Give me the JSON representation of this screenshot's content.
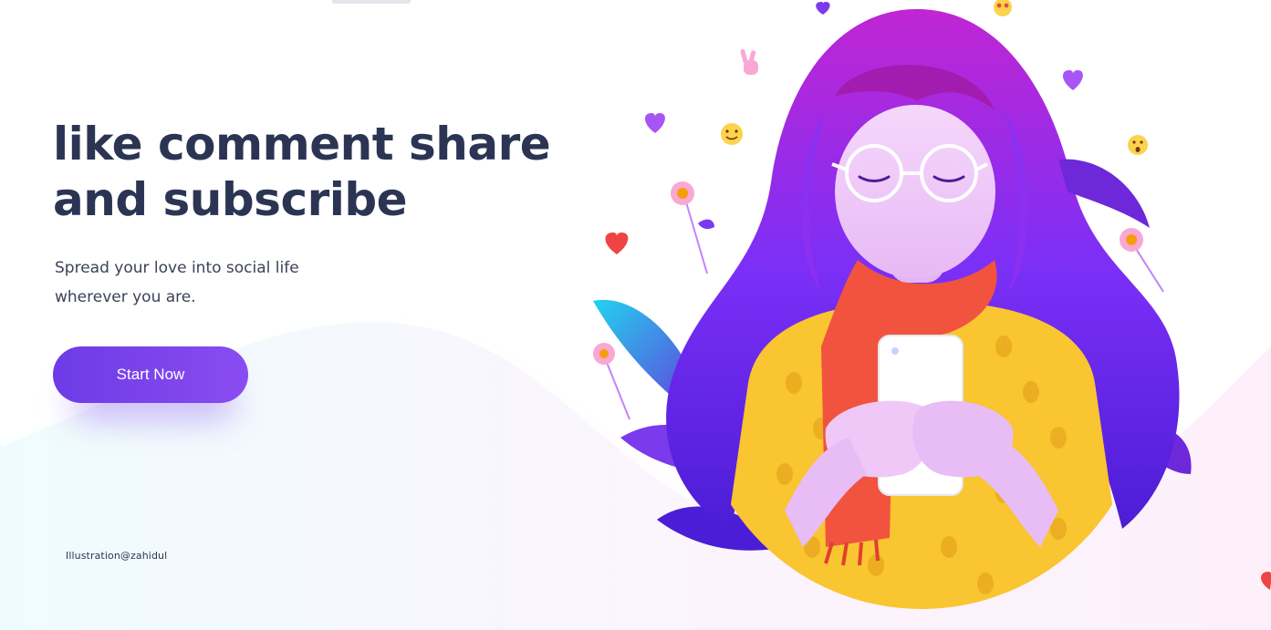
{
  "hero": {
    "title_line1": "like comment share",
    "title_line2": "and subscribe",
    "subtitle_line1": "Spread your love into social life",
    "subtitle_line2": "wherever you are."
  },
  "cta": {
    "label": "Start Now"
  },
  "credit": {
    "text": "Illustration@zahidul"
  },
  "colors": {
    "title": "#2b3553",
    "body_text": "#3b4258",
    "accent": "#7c3aed",
    "hair": "#7b2ff7",
    "sweater": "#f9c531",
    "scarf": "#f2533f"
  },
  "icons": [
    "heart-emoji-icon",
    "smiley-emoji-icon",
    "heart-eyes-emoji-icon",
    "surprised-emoji-icon",
    "peace-hand-emoji-icon",
    "flower-icon"
  ]
}
